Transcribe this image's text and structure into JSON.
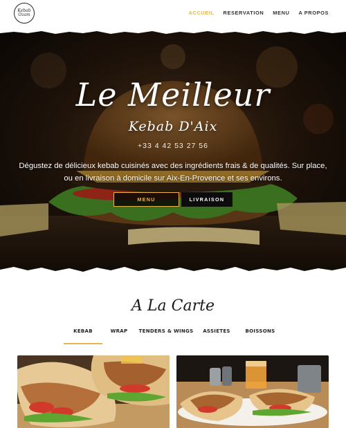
{
  "brand": {
    "logo_line1": "Kebab",
    "logo_line2": "Ozam"
  },
  "nav": {
    "items": [
      {
        "label": "ACCUEIL",
        "active": true
      },
      {
        "label": "RESERVATION",
        "active": false
      },
      {
        "label": "MENU",
        "active": false
      },
      {
        "label": "A PROPOS",
        "active": false
      }
    ]
  },
  "hero": {
    "title": "Le Meilleur",
    "subtitle": "Kebab D'Aix",
    "phone": "+33 4 42 53 27 56",
    "description": "Dégustez de délicieux kebab cuisinés avec des ingrédients frais & de qualités. Sur place, ou en livraison à domicile sur Aix-En-Provence et ses environs.",
    "button_menu": "MENU",
    "button_livraison": "LIVRAISON"
  },
  "carte": {
    "title": "A La Carte",
    "tabs": [
      {
        "label": "KEBAB",
        "active": true
      },
      {
        "label": "WRAP",
        "active": false
      },
      {
        "label": "TENDERS & WINGS",
        "active": false
      },
      {
        "label": "ASSIETES",
        "active": false
      },
      {
        "label": "BOISSONS",
        "active": false
      }
    ]
  },
  "colors": {
    "accent": "#e6b64c",
    "dark": "#111111",
    "text": "#222222"
  }
}
